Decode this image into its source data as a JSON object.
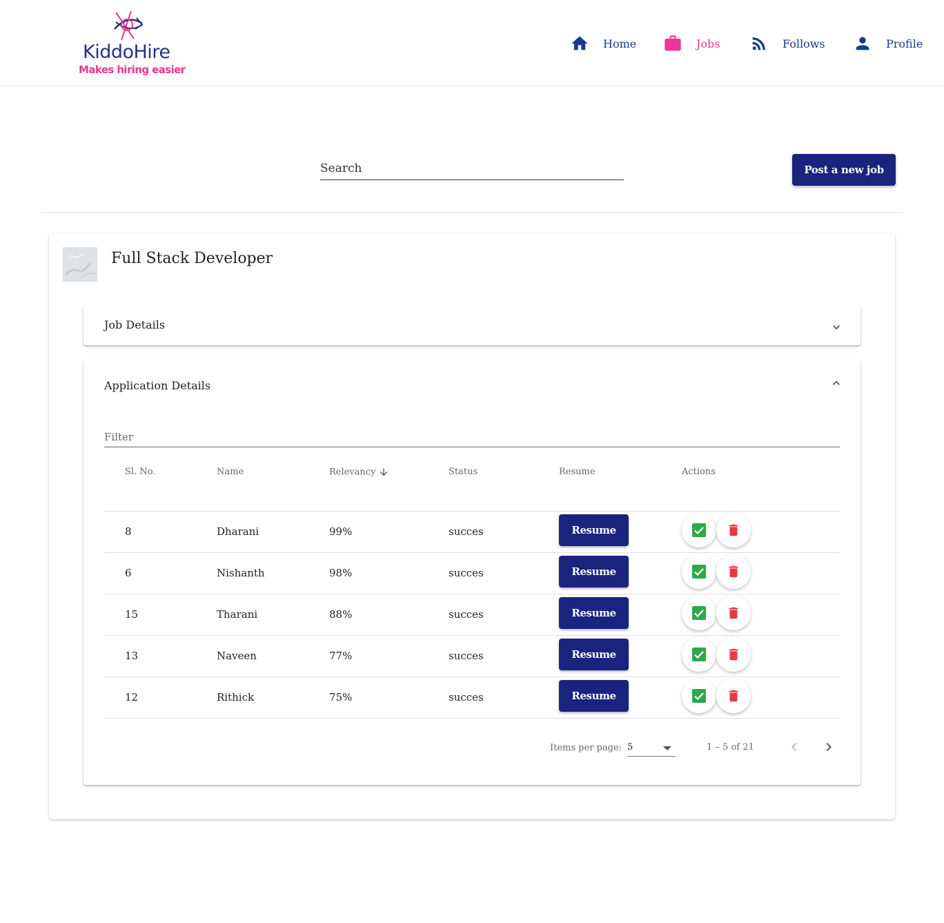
{
  "brand": {
    "name": "KiddoHire",
    "tagline": "Makes hiring easier",
    "primary_color": "#1a237e",
    "accent_color": "#e8388f"
  },
  "nav": [
    {
      "label": "Home",
      "icon": "home-icon",
      "active": false
    },
    {
      "label": "Jobs",
      "icon": "briefcase-icon",
      "active": true
    },
    {
      "label": "Follows",
      "icon": "rss-feed-icon",
      "active": false
    },
    {
      "label": "Profile",
      "icon": "person-icon",
      "active": false
    }
  ],
  "toolbar": {
    "search_placeholder": "Search",
    "post_job_label": "Post a new job"
  },
  "job": {
    "title": "Full Stack Developer",
    "job_details_title": "Job Details",
    "job_details_expanded": false,
    "application_details_title": "Application Details",
    "application_details_expanded": true
  },
  "applications": {
    "filter_placeholder": "Filter",
    "columns": [
      "Sl. No.",
      "Name",
      "Relevancy",
      "Status",
      "Resume",
      "Actions"
    ],
    "sort_column": "Relevancy",
    "sort_direction": "desc",
    "resume_label": "Resume",
    "approve_icon": "check-box-icon",
    "reject_icon": "trash-icon",
    "approve_color": "#2ea84a",
    "reject_color": "#e53945",
    "rows": [
      {
        "sl": "8",
        "name": "Dharani",
        "relevancy": "99%",
        "status": "succes"
      },
      {
        "sl": "6",
        "name": "Nishanth",
        "relevancy": "98%",
        "status": "succes"
      },
      {
        "sl": "15",
        "name": "Tharani",
        "relevancy": "88%",
        "status": "succes"
      },
      {
        "sl": "13",
        "name": "Naveen",
        "relevancy": "77%",
        "status": "succes"
      },
      {
        "sl": "12",
        "name": "Rithick",
        "relevancy": "75%",
        "status": "succes"
      }
    ],
    "paginator": {
      "items_per_page_label": "Items per page:",
      "items_per_page": "5",
      "range_label": "1 – 5 of 21"
    }
  }
}
